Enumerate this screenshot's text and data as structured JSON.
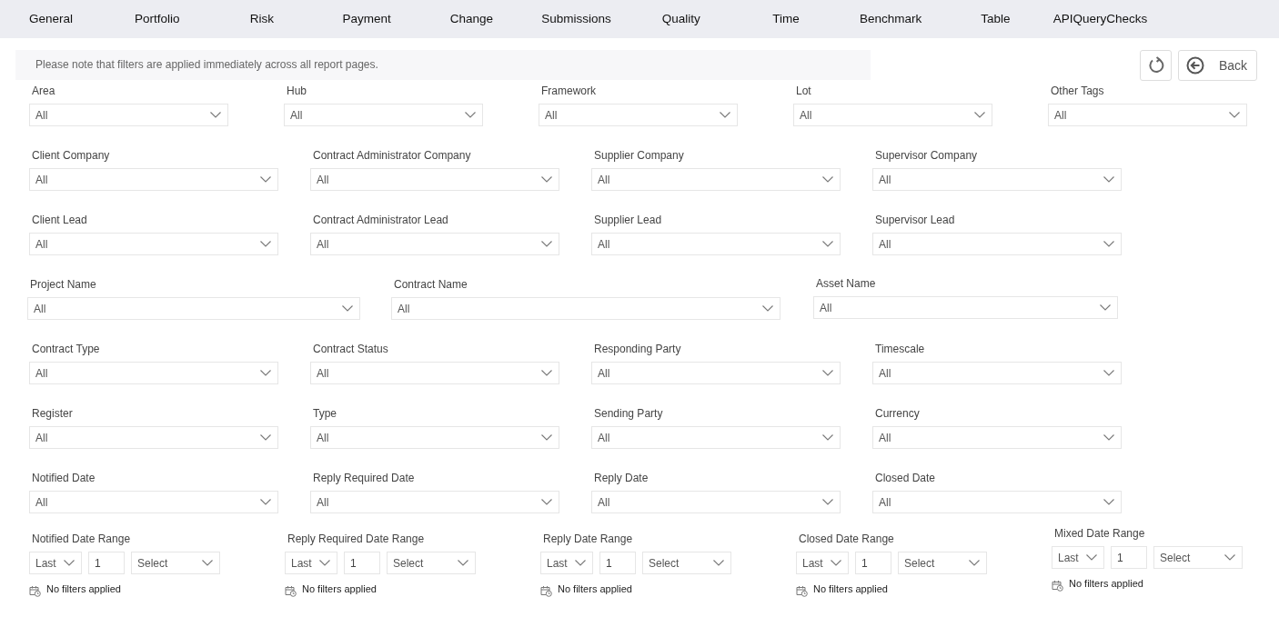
{
  "tabs": [
    {
      "label": "General",
      "selected": false
    },
    {
      "label": "Portfolio",
      "selected": false
    },
    {
      "label": "Risk",
      "selected": false
    },
    {
      "label": "Payment",
      "selected": false
    },
    {
      "label": "Change",
      "selected": false
    },
    {
      "label": "Submissions",
      "selected": false
    },
    {
      "label": "Quality",
      "selected": false
    },
    {
      "label": "Time",
      "selected": false
    },
    {
      "label": "Benchmark",
      "selected": false
    },
    {
      "label": "Table",
      "selected": false
    },
    {
      "label": "APIQueryChecks",
      "selected": false
    }
  ],
  "notice": "Please note that filters are applied immediately across all report pages.",
  "back_button": {
    "label": "Back"
  },
  "filter_rows": [
    [
      {
        "label": "Area",
        "value": "All"
      },
      {
        "label": "Hub",
        "value": "All"
      },
      {
        "label": "Framework",
        "value": "All"
      },
      {
        "label": "Lot",
        "value": "All"
      },
      {
        "label": "Other Tags",
        "value": "All"
      }
    ],
    [
      {
        "label": "Client Company",
        "value": "All"
      },
      {
        "label": "Contract Administrator Company",
        "value": "All"
      },
      {
        "label": "Supplier Company",
        "value": "All"
      },
      {
        "label": "Supervisor Company",
        "value": "All"
      }
    ],
    [
      {
        "label": "Client Lead",
        "value": "All"
      },
      {
        "label": "Contract Administrator Lead",
        "value": "All"
      },
      {
        "label": "Supplier Lead",
        "value": "All"
      },
      {
        "label": "Supervisor Lead",
        "value": "All"
      }
    ],
    [
      {
        "label": "Project Name",
        "value": "All"
      },
      {
        "label": "Contract Name",
        "value": "All"
      },
      {
        "label": "Asset Name",
        "value": "All"
      }
    ],
    [
      {
        "label": "Contract Type",
        "value": "All"
      },
      {
        "label": "Contract Status",
        "value": "All"
      },
      {
        "label": "Responding Party",
        "value": "All"
      },
      {
        "label": "Timescale",
        "value": "All"
      }
    ],
    [
      {
        "label": "Register",
        "value": "All"
      },
      {
        "label": "Type",
        "value": "All"
      },
      {
        "label": "Sending Party",
        "value": "All"
      },
      {
        "label": "Currency",
        "value": "All"
      }
    ],
    [
      {
        "label": "Notified Date",
        "value": "All"
      },
      {
        "label": "Reply Required Date",
        "value": "All"
      },
      {
        "label": "Reply Date",
        "value": "All"
      },
      {
        "label": "Closed Date",
        "value": "All"
      }
    ]
  ],
  "date_ranges": [
    {
      "label": "Notified Date Range",
      "period": "Last",
      "count": "1",
      "unit": "Select",
      "status": "No filters applied"
    },
    {
      "label": "Reply Required Date Range",
      "period": "Last",
      "count": "1",
      "unit": "Select",
      "status": "No filters applied"
    },
    {
      "label": "Reply Date Range",
      "period": "Last",
      "count": "1",
      "unit": "Select",
      "status": "No filters applied"
    },
    {
      "label": "Closed Date Range",
      "period": "Last",
      "count": "1",
      "unit": "Select",
      "status": "No filters applied"
    },
    {
      "label": "Mixed Date Range",
      "period": "Last",
      "count": "1",
      "unit": "Select",
      "status": "No filters applied"
    }
  ]
}
